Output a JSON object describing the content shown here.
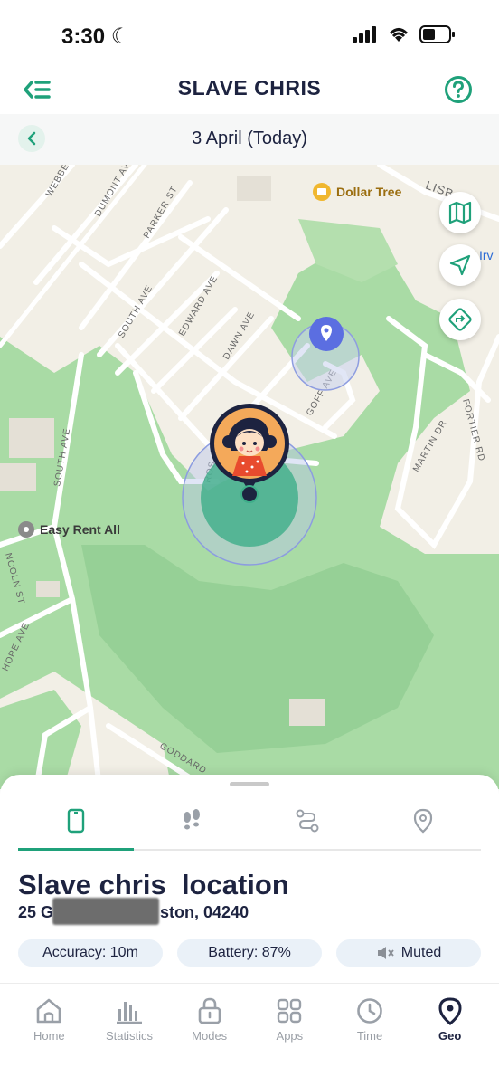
{
  "status_bar": {
    "time": "3:30"
  },
  "header": {
    "title": "SLAVE CHRIS"
  },
  "date_bar": {
    "label": "3 April (Today)"
  },
  "map": {
    "street_labels": [
      "WEBBER",
      "DUMONT AVE",
      "PARKER ST",
      "SOUTH AVE",
      "EDWARD AVE",
      "DAWN AVE",
      "GOFF AVE",
      "MARTIN DR",
      "FORTIER RD",
      "SOUTH AVE",
      "NCOLN ST",
      "HOPE AVE",
      "GODDARD",
      "ROS",
      "LISB"
    ],
    "poi_dollar_tree": "Dollar Tree",
    "poi_easy_rent": "Easy Rent All",
    "poi_partial": "Irv"
  },
  "sheet": {
    "title": "Slave chris  location",
    "address_start": "25 G",
    "address_end": "ston, 04240",
    "chips": {
      "accuracy": "Accuracy: 10m",
      "battery": "Battery: 87%",
      "muted": "Muted"
    }
  },
  "nav": [
    {
      "label": "Home",
      "icon": "home-icon"
    },
    {
      "label": "Statistics",
      "icon": "statistics-icon"
    },
    {
      "label": "Modes",
      "icon": "lock-icon"
    },
    {
      "label": "Apps",
      "icon": "apps-icon"
    },
    {
      "label": "Time",
      "icon": "clock-icon"
    },
    {
      "label": "Geo",
      "icon": "geo-pin-icon"
    }
  ],
  "colors": {
    "accent": "#1fa17a",
    "title": "#1d2340",
    "park": "#9ed6a0",
    "pin_blue": "#5b6ee1"
  }
}
